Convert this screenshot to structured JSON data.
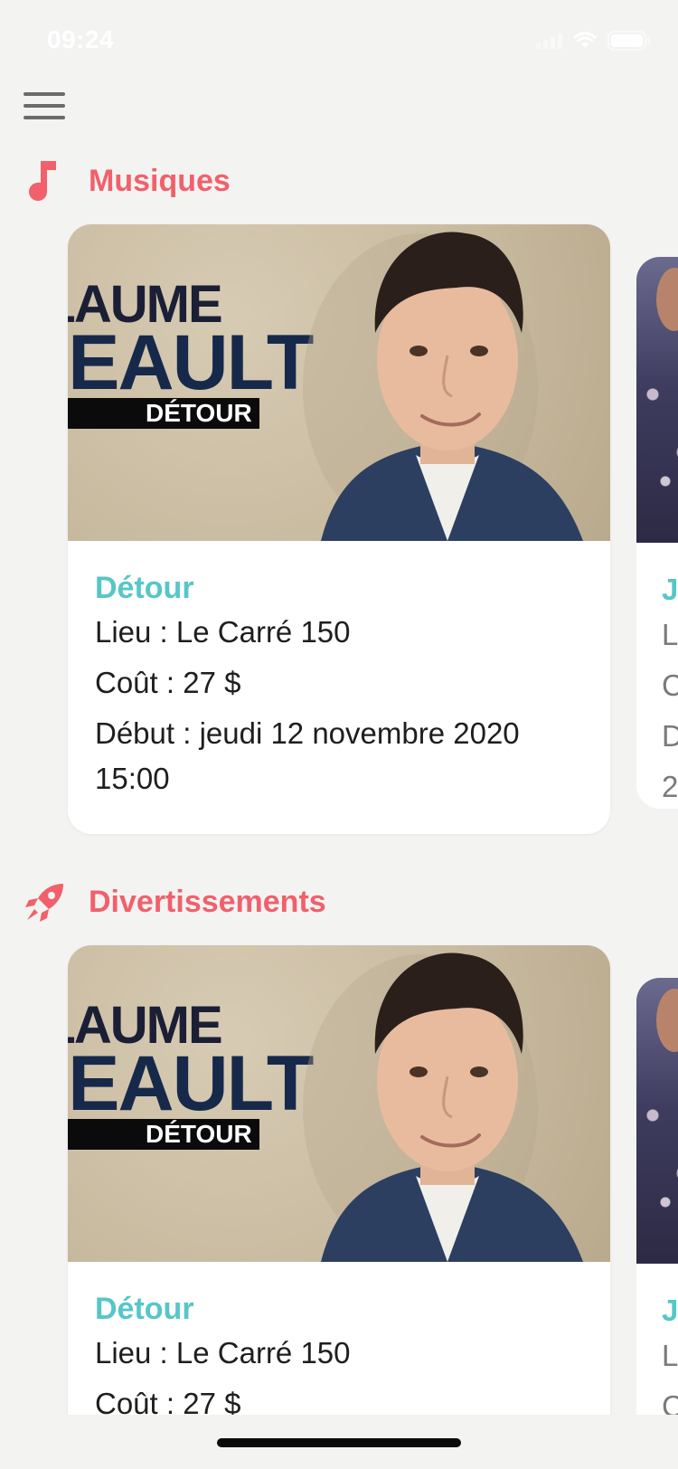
{
  "status_bar": {
    "time": "09:24"
  },
  "sections": [
    {
      "title": "Musiques",
      "icon": "music-note-icon",
      "card": {
        "poster": {
          "line1": "LLAUME",
          "line2": "NEAULT",
          "subtitle": "DÉTOUR"
        },
        "title": "Détour",
        "lieu": "Lieu : Le Carré 150",
        "cout": "Coût : 27 $",
        "debut_line1": "Début : jeudi 12 novembre 2020",
        "debut_line2": "15:00"
      },
      "peek": {
        "title": "J",
        "line1": "L",
        "line2": "C",
        "line3": "D",
        "line4": "2"
      }
    },
    {
      "title": "Divertissements",
      "icon": "rocket-icon",
      "card": {
        "poster": {
          "line1": "LLAUME",
          "line2": "NEAULT",
          "subtitle": "DÉTOUR"
        },
        "title": "Détour",
        "lieu": "Lieu : Le Carré 150",
        "cout": "Coût : 27 $"
      },
      "peek": {
        "title": "J",
        "line1": "L",
        "line2": "C"
      }
    }
  ],
  "colors": {
    "accent": "#f1606b",
    "title": "#57c6c7",
    "background": "#f3f3f2"
  }
}
